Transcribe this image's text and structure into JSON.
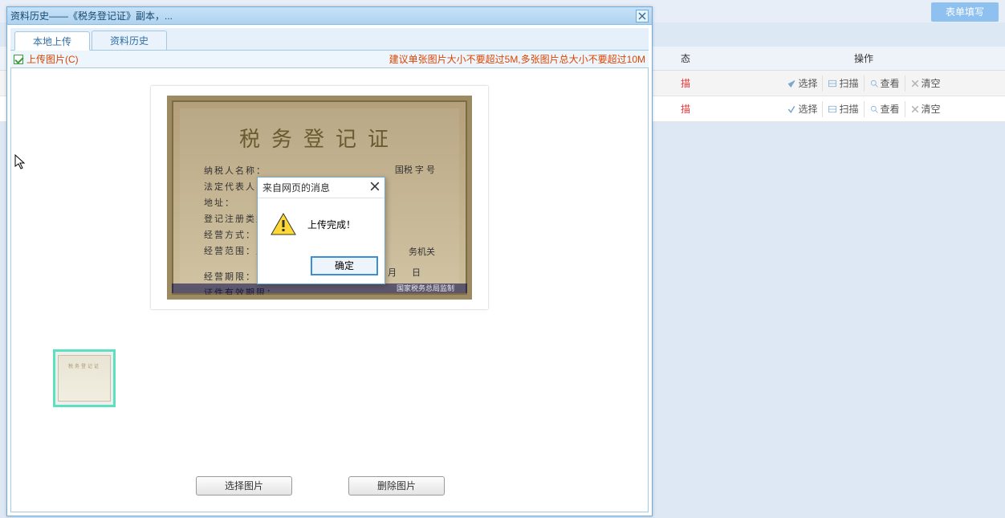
{
  "bg": {
    "form_tab": "表单填写",
    "head_status": "态",
    "head_ops": "操作",
    "row_status": "描",
    "ops": {
      "select": "选择",
      "scan": "扫描",
      "view": "查看",
      "clear": "清空"
    }
  },
  "modal": {
    "title": "资料历史——《税务登记证》副本，...",
    "tabs": {
      "local": "本地上传",
      "history": "资料历史"
    },
    "upload_label": "上传图片(C)",
    "hint": "建议单张图片大小不要超过5M,多张图片总大小不要超过10M",
    "cert": {
      "title": "税务登记证",
      "l1": "纳税人名称：",
      "l2": "法定代表人：",
      "l3": "地址：",
      "l4": "登记注册类型：",
      "l5": "经营方式：",
      "l6": "经营范围：主",
      "l7": "经营期限：",
      "l8": "证件有效期限：",
      "r1": "国税 字          号",
      "b1": "务机关",
      "b2": "月    日",
      "footer": "国家税务总局监制"
    },
    "thumb_title": "税务登记证",
    "btn_select": "选择图片",
    "btn_delete": "删除图片"
  },
  "alert": {
    "title": "来自网页的消息",
    "msg": "上传完成！",
    "ok": "确定"
  }
}
